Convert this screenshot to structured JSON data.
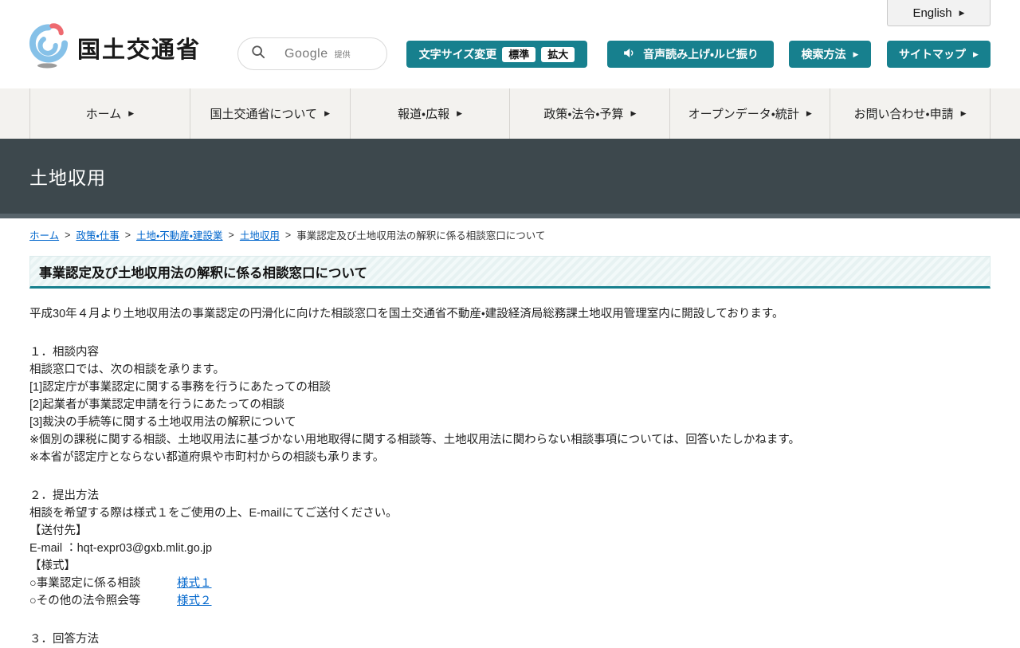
{
  "header": {
    "site_name": "国土交通省",
    "search": {
      "engine": "Google",
      "provided_by": "提供"
    },
    "font_size_changer": {
      "label": "文字サイズ変更",
      "standard": "標準",
      "large": "拡大"
    },
    "speech_label": "音声読み上げ・ルビ振り",
    "search_method_label": "検索方法",
    "sitemap_label": "サイトマップ",
    "english_label": "English"
  },
  "nav": {
    "items": [
      {
        "label": "ホーム"
      },
      {
        "label": "国土交通省について"
      },
      {
        "label": "報道・広報"
      },
      {
        "label": "政策・法令・予算"
      },
      {
        "label": "オープンデータ・統計"
      },
      {
        "label": "お問い合わせ・申請"
      }
    ]
  },
  "banner": {
    "title": "土地収用"
  },
  "breadcrumb": {
    "separator": ">",
    "links": [
      {
        "label": "ホーム"
      },
      {
        "label": "政策・仕事"
      },
      {
        "label": "土地・不動産・建設業"
      },
      {
        "label": "土地収用"
      }
    ],
    "current": "事業認定及び土地収用法の解釈に係る相談窓口について"
  },
  "page": {
    "title": "事業認定及び土地収用法の解釈に係る相談窓口について",
    "intro": "平成30年４月より土地収用法の事業認定の円滑化に向けた相談窓口を国土交通省不動産・建設経済局総務課土地収用管理室内に開設しております。",
    "section1": {
      "heading": "１．相談内容",
      "lines": [
        "相談窓口では、次の相談を承ります。",
        "[1]認定庁が事業認定に関する事務を行うにあたっての相談",
        "[2]起業者が事業認定申請を行うにあたっての相談",
        "[3]裁決の手続等に関する土地収用法の解釈について",
        "※個別の課税に関する相談、土地収用法に基づかない用地取得に関する相談等、土地収用法に関わらない相談事項については、回答いたしかねます。",
        "※本省が認定庁とならない都道府県や市町村からの相談も承ります。"
      ]
    },
    "section2": {
      "heading": "２．提出方法",
      "lines": [
        "相談を希望する際は様式１をご使用の上、E-mailにてご送付ください。",
        "【送付先】",
        "E-mail ：hqt-expr03@gxb.mlit.go.jp",
        "【様式】"
      ],
      "forms": [
        {
          "label": "○事業認定に係る相談",
          "link": "様式１"
        },
        {
          "label": "○その他の法令照会等",
          "link": "様式２"
        }
      ]
    },
    "section3": {
      "heading": "３．回答方法"
    }
  },
  "icons": {
    "arrow": "▶"
  },
  "colors": {
    "accent_teal": "#17808e",
    "banner_dark": "#3d484d",
    "link_blue": "#0066cc"
  }
}
